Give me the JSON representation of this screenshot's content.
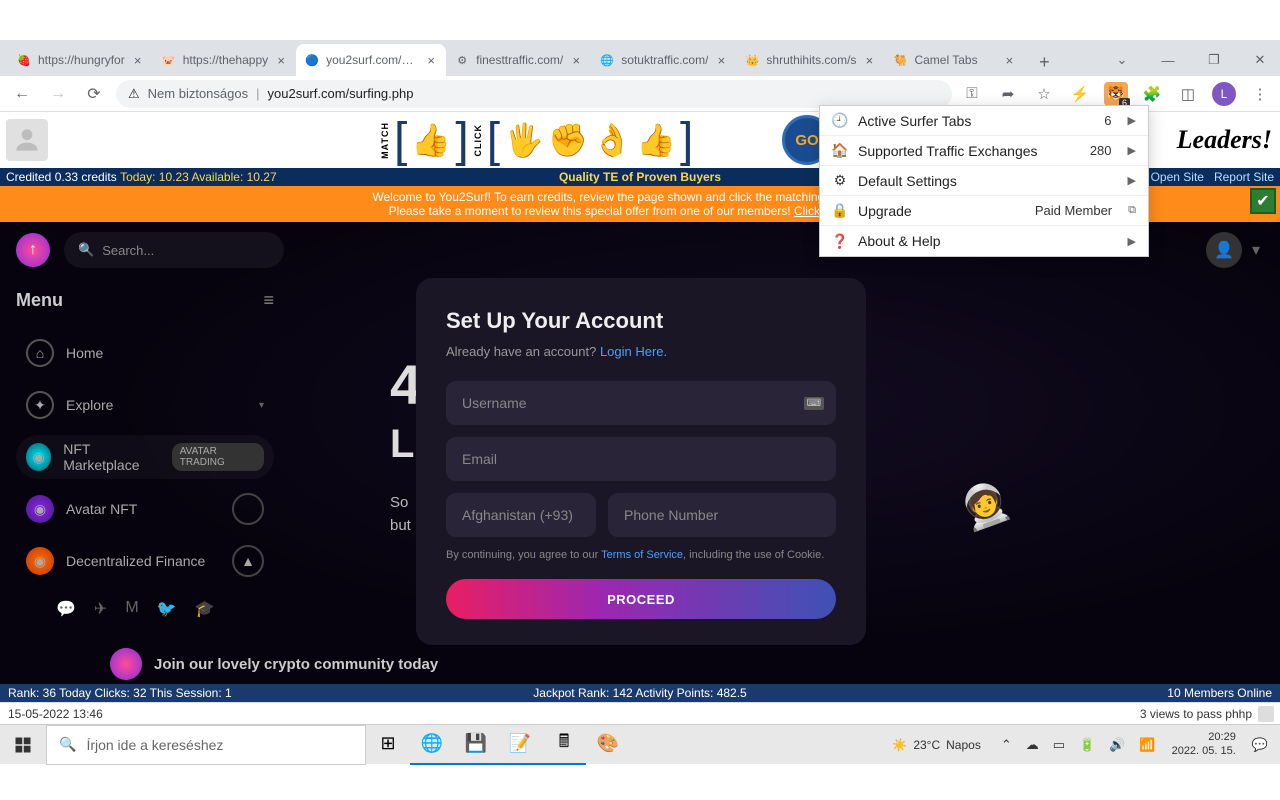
{
  "tabs": [
    {
      "title": "https://hungryfor",
      "favicon": "🍓"
    },
    {
      "title": "https://thehappy",
      "favicon": "🐷"
    },
    {
      "title": "you2surf.com/sur",
      "favicon": "🔵",
      "active": true
    },
    {
      "title": "finesttraffic.com/",
      "favicon": "⚙"
    },
    {
      "title": "sotuktraffic.com/",
      "favicon": "🌐"
    },
    {
      "title": "shruthihits.com/s",
      "favicon": "👑"
    },
    {
      "title": "Camel Tabs",
      "favicon": "🐫"
    }
  ],
  "omnibox": {
    "warning": "Nem biztonságos",
    "url": "you2surf.com/surfing.php"
  },
  "avatar_letter": "L",
  "ext_badge_count": "6",
  "surfbar": {
    "go": "GO",
    "leaders": "Leaders!"
  },
  "ext_popup": [
    {
      "icon": "🕘",
      "label": "Active Surfer Tabs",
      "value": "6",
      "chev": true
    },
    {
      "icon": "🏠",
      "label": "Supported Traffic Exchanges",
      "value": "280",
      "chev": true
    },
    {
      "icon": "⚙",
      "label": "Default Settings",
      "value": "",
      "chev": true
    },
    {
      "icon": "🔒",
      "label": "Upgrade",
      "value": "Paid Member",
      "copy": true
    },
    {
      "icon": "❓",
      "label": "About & Help",
      "value": "",
      "chev": true
    }
  ],
  "credits": {
    "left_a": "Credited 0.33 credits",
    "left_b": "Today: 10.23 Available: 10.27",
    "center": "Quality TE of Proven Buyers",
    "open": "Open Site",
    "report": "Report Site"
  },
  "banner": {
    "line1": "Welcome to You2Surf! To earn credits, review the page shown and click the matching icons when the",
    "line2a": "Please take a moment to review this special offer from one of our members! ",
    "line2b": "Click here to reser"
  },
  "dark": {
    "search_placeholder": "Search...",
    "menu_title": "Menu",
    "items": [
      {
        "label": "Home"
      },
      {
        "label": "Explore"
      },
      {
        "label": "NFT Marketplace",
        "badge": "AVATAR TRADING"
      },
      {
        "label": "Avatar NFT"
      },
      {
        "label": "Decentralized Finance"
      }
    ],
    "bg_404": "4(",
    "bg_lo": "L(",
    "bg_text1": "So",
    "bg_text2": "but",
    "community": "Join our lovely crypto community today"
  },
  "signup": {
    "title": "Set Up Your Account",
    "sub_a": "Already have an account? ",
    "sub_b": "Login Here.",
    "ph_user": "Username",
    "ph_email": "Email",
    "ph_country": "Afghanistan (+93)",
    "ph_phone": "Phone Number",
    "terms_a": "By continuing, you agree to our ",
    "terms_b": "Terms of Service",
    "terms_c": ", including the use of Cookie.",
    "proceed": "PROCEED"
  },
  "status": {
    "blue_left": "Rank: 36 Today Clicks: 32 This Session: 1",
    "blue_center": "Jackpot Rank: 142 Activity Points: 482.5",
    "blue_right": "10 Members Online",
    "white_left": "15-05-2022 13:46",
    "white_right": "3 views to pass phhp"
  },
  "taskbar": {
    "search_placeholder": "Írjon ide a kereséshez",
    "weather_temp": "23°C",
    "weather_cond": "Napos",
    "time": "20:29",
    "date": "2022. 05. 15."
  }
}
